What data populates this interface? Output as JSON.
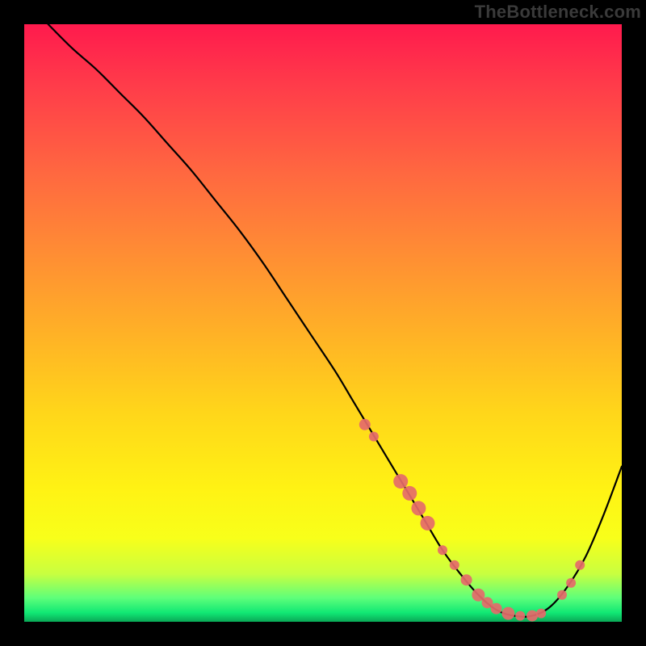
{
  "watermark": "TheBottleneck.com",
  "colors": {
    "curve_stroke": "#000000",
    "marker_fill": "#e56a6a",
    "marker_stroke": "#e56a6a",
    "background": "#000000"
  },
  "chart_data": {
    "type": "line",
    "title": "",
    "xlabel": "",
    "ylabel": "",
    "xlim": [
      0,
      100
    ],
    "ylim": [
      0,
      100
    ],
    "curve": {
      "x": [
        4,
        8,
        12,
        16,
        20,
        24,
        28,
        32,
        36,
        40,
        44,
        48,
        52,
        55,
        58,
        61,
        64,
        67,
        70,
        73,
        76,
        79,
        82,
        85,
        88,
        91,
        94,
        97,
        100
      ],
      "y": [
        100,
        96,
        92.5,
        88.5,
        84.5,
        80,
        75.5,
        70.5,
        65.5,
        60,
        54,
        48,
        42,
        37,
        32,
        27,
        22,
        17,
        12,
        8,
        4.5,
        2,
        1,
        1,
        2.5,
        6,
        11,
        18,
        26
      ]
    },
    "markers": {
      "x": [
        57,
        58.5,
        63,
        64.5,
        66,
        67.5,
        70,
        72,
        74,
        76,
        77.5,
        79,
        81,
        83,
        85,
        86.5,
        90,
        91.5,
        93
      ],
      "y": [
        33,
        31,
        23.5,
        21.5,
        19,
        16.5,
        12,
        9.5,
        7,
        4.5,
        3.2,
        2.2,
        1.4,
        1,
        1,
        1.4,
        4.5,
        6.5,
        9.5
      ],
      "r": [
        7,
        6,
        9,
        9,
        9,
        9,
        6,
        6,
        7,
        8,
        7,
        7,
        8,
        6,
        7,
        6,
        6,
        6,
        6
      ]
    }
  }
}
